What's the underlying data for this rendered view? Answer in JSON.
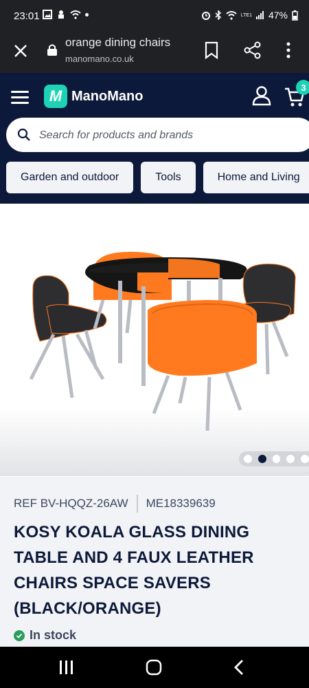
{
  "status_bar": {
    "time": "23:01",
    "battery": "47%",
    "network": "LTE1"
  },
  "browser": {
    "page_title": "orange dining chairs",
    "domain": "manomano.co.uk"
  },
  "site": {
    "logo_letter": "M",
    "logo_text": "ManoMano",
    "cart_count": "3",
    "search_placeholder": "Search for products and brands",
    "categories": [
      "Garden and outdoor",
      "Tools",
      "Home and Living"
    ]
  },
  "gallery": {
    "image_count": 5,
    "active_index": 1
  },
  "product": {
    "ref": "REF BV-HQQZ-26AW",
    "code": "ME18339639",
    "title": "KOSY KOALA GLASS DINING TABLE AND 4 FAUX LEATHER CHAIRS SPACE SAVERS (BLACK/ORANGE)",
    "stock_status": "In stock"
  },
  "colors": {
    "brand_navy": "#0c193a",
    "brand_teal": "#1fd2b6",
    "stock_green": "#2a9d5c",
    "chair_orange": "#ff7a1f"
  }
}
